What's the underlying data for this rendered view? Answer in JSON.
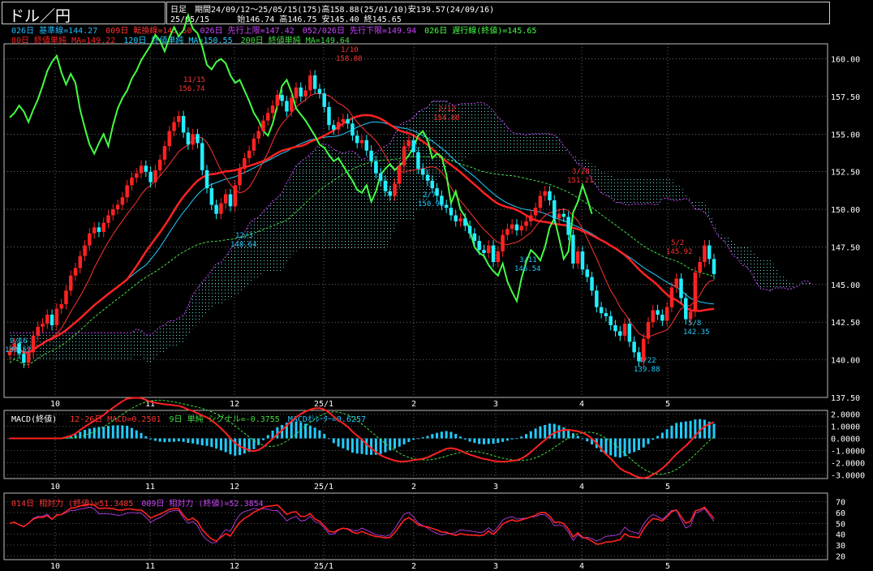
{
  "header": {
    "title": "ドル／円",
    "timeframe": "日足",
    "info_line1": "期間24/09/12～25/05/15(175)高158.88(25/01/10)安139.57(24/09/16)",
    "info_line2_date": "25/05/15",
    "info_line2_ohlc": "始146.74 高146.75 安145.40 終145.65"
  },
  "legend_row1": [
    {
      "text": "026日 基準線=144.27",
      "color": "#22bbff"
    },
    {
      "text": "009日 転換線=145.50",
      "color": "#ff3333"
    },
    {
      "text": "026日 先行上限=147.42",
      "color": "#cc44ff"
    },
    {
      "text": "052/026日 先行下限=149.94",
      "color": "#cc44ff"
    },
    {
      "text": "026日 遅行線(終値)=145.65",
      "color": "#44ff44"
    }
  ],
  "legend_row2": [
    {
      "text": "80日 終値単純 MA=149.22",
      "color": "#ff2222"
    },
    {
      "text": "120日 終値単純 MA=150.55",
      "color": "#22ccff"
    },
    {
      "text": "200日 終値単純 MA=149.64",
      "color": "#44dd44"
    }
  ],
  "macd_legend": [
    {
      "text": "MACD(終値)",
      "color": "#ffffff"
    },
    {
      "text": "12-26日 MACD=0.2501",
      "color": "#ff3333"
    },
    {
      "text": "9日 単純 シグナル=-0.3755",
      "color": "#44dd44"
    },
    {
      "text": "MACDｵｼﾚｰﾀｰ=0.6257",
      "color": "#22ccff"
    }
  ],
  "rsi_legend": [
    {
      "text": "014日 相対力 (終値)=51.3485",
      "color": "#ff3333"
    },
    {
      "text": "009日 相対力 (終値)=52.3854",
      "color": "#cc44ff"
    }
  ],
  "x_labels": [
    "10",
    "11",
    "12",
    "25/1",
    "2",
    "3",
    "4",
    "5"
  ],
  "price_axis": [
    "160.00",
    "157.50",
    "155.00",
    "152.50",
    "150.00",
    "147.50",
    "145.00",
    "142.50",
    "140.00",
    "137.50"
  ],
  "macd_axis": [
    "2.0000",
    "1.0000",
    "0.0000",
    "-1.0000",
    "-2.0000",
    "-3.0000"
  ],
  "rsi_axis": [
    "70",
    "60",
    "50",
    "40",
    "30",
    "20"
  ],
  "annotations": [
    {
      "date": "9/16",
      "value": "139.57",
      "color": "#22ccff"
    },
    {
      "date": "11/15",
      "value": "156.74",
      "color": "#ff3333"
    },
    {
      "date": "12/3",
      "value": "148.64",
      "color": "#22ccff"
    },
    {
      "date": "1/10",
      "value": "158.88",
      "color": "#ff3333"
    },
    {
      "date": "2/12",
      "value": "154.80",
      "color": "#ff3333"
    },
    {
      "date": "2/7",
      "value": "150.92",
      "color": "#22ccff"
    },
    {
      "date": "3/11",
      "value": "146.54",
      "color": "#22ccff"
    },
    {
      "date": "4/22",
      "value": "139.88",
      "color": "#22ccff"
    },
    {
      "date": "5/2",
      "value": "145.92",
      "color": "#ff3333"
    },
    {
      "date": "5/8",
      "value": "142.35",
      "color": "#22ccff"
    },
    {
      "date": "3/28",
      "value": "151.21",
      "color": "#ff3333"
    }
  ],
  "colors": {
    "up": "#ff2222",
    "down": "#22eeff",
    "grid": "#aaaaaa",
    "cloud": "#66dddd",
    "cloud_edge": "#cc44ff",
    "ma80": "#ff2222",
    "ma120": "#22ccff",
    "ma200": "#44dd44",
    "chikou": "#44ff44"
  },
  "chart_data": {
    "type": "candlestick",
    "title": "ドル／円 日足",
    "y_range": [
      137.5,
      161.0
    ],
    "months_x": [
      "10",
      "11",
      "12",
      "25/1",
      "2",
      "3",
      "4",
      "5"
    ],
    "closes": [
      140.6,
      141.1,
      140.4,
      139.8,
      140.5,
      141.6,
      142.2,
      142.4,
      143.0,
      142.3,
      143.4,
      143.7,
      144.6,
      145.6,
      146.1,
      146.9,
      147.6,
      148.4,
      148.8,
      148.5,
      149.1,
      149.6,
      150.0,
      150.3,
      150.8,
      151.6,
      152.1,
      152.4,
      152.9,
      152.5,
      151.8,
      152.6,
      153.3,
      154.2,
      155.2,
      155.8,
      156.2,
      155.1,
      154.3,
      155.0,
      154.4,
      152.6,
      151.4,
      150.3,
      149.7,
      150.4,
      151.0,
      150.2,
      151.6,
      152.7,
      153.4,
      153.9,
      154.7,
      155.2,
      155.9,
      156.4,
      156.9,
      157.6,
      157.2,
      156.5,
      157.4,
      158.1,
      157.5,
      157.9,
      158.9,
      158.0,
      157.7,
      156.8,
      155.6,
      155.3,
      155.8,
      156.0,
      155.7,
      154.9,
      154.4,
      154.6,
      153.9,
      153.2,
      152.4,
      151.9,
      151.2,
      150.9,
      151.7,
      152.9,
      154.2,
      154.6,
      153.8,
      152.7,
      152.3,
      151.9,
      151.4,
      150.9,
      150.3,
      150.1,
      149.6,
      149.2,
      149.4,
      148.9,
      148.4,
      147.9,
      147.3,
      147.1,
      147.6,
      146.5,
      147.2,
      148.3,
      148.7,
      149.0,
      148.6,
      148.9,
      149.2,
      149.6,
      150.1,
      150.9,
      151.2,
      150.6,
      149.4,
      149.7,
      149.5,
      148.3,
      146.4,
      147.2,
      146.0,
      145.5,
      144.6,
      143.5,
      143.1,
      142.9,
      142.3,
      141.9,
      141.6,
      142.4,
      141.2,
      140.5,
      139.9,
      141.4,
      142.5,
      143.3,
      143.0,
      142.6,
      143.5,
      144.8,
      145.4,
      144.1,
      142.7,
      143.2,
      145.8,
      146.5,
      147.6,
      146.7,
      145.7
    ]
  }
}
